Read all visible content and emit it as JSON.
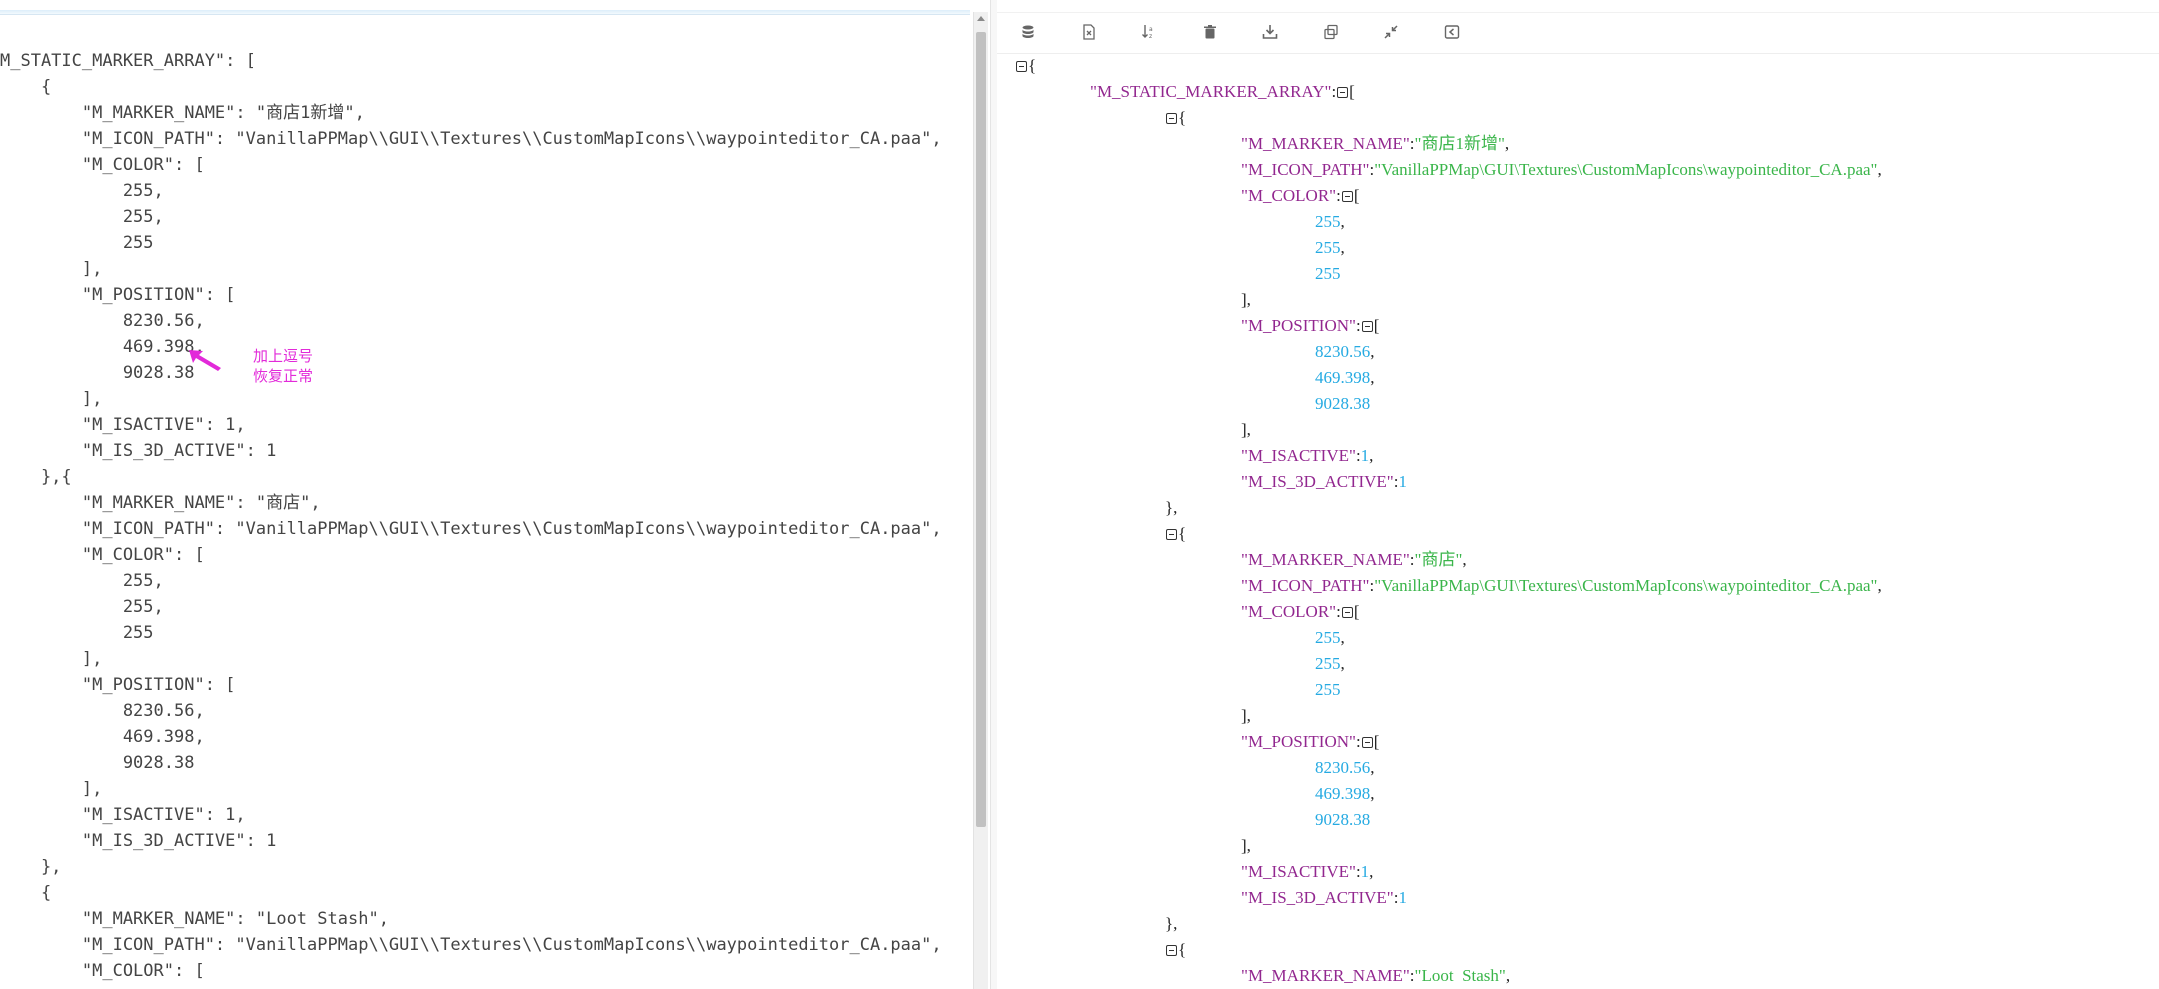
{
  "raw_editor": {
    "lines": [
      "M_STATIC_MARKER_ARRAY\": [",
      "    {",
      "        \"M_MARKER_NAME\": \"商店1新增\",",
      "        \"M_ICON_PATH\": \"VanillaPPMap\\\\GUI\\\\Textures\\\\CustomMapIcons\\\\waypointeditor_CA.paa\",",
      "        \"M_COLOR\": [",
      "            255,",
      "            255,",
      "            255",
      "        ],",
      "        \"M_POSITION\": [",
      "            8230.56,",
      "            469.398,",
      "            9028.38",
      "        ],",
      "        \"M_ISACTIVE\": 1,",
      "        \"M_IS_3D_ACTIVE\": 1",
      "    },{",
      "        \"M_MARKER_NAME\": \"商店\",",
      "        \"M_ICON_PATH\": \"VanillaPPMap\\\\GUI\\\\Textures\\\\CustomMapIcons\\\\waypointeditor_CA.paa\",",
      "        \"M_COLOR\": [",
      "            255,",
      "            255,",
      "            255",
      "        ],",
      "        \"M_POSITION\": [",
      "            8230.56,",
      "            469.398,",
      "            9028.38",
      "        ],",
      "        \"M_ISACTIVE\": 1,",
      "        \"M_IS_3D_ACTIVE\": 1",
      "    },",
      "    {",
      "        \"M_MARKER_NAME\": \"Loot Stash\",",
      "        \"M_ICON_PATH\": \"VanillaPPMap\\\\GUI\\\\Textures\\\\CustomMapIcons\\\\waypointeditor_CA.paa\",",
      "        \"M_COLOR\": ["
    ],
    "annotation": {
      "line1": "加上逗号",
      "line2": "恢复正常",
      "color": "#e22ad9"
    }
  },
  "toolbar": {
    "buttons": [
      {
        "name": "format-icon"
      },
      {
        "name": "compress-icon"
      },
      {
        "name": "sort-icon"
      },
      {
        "name": "clear-icon"
      },
      {
        "name": "download-icon"
      },
      {
        "name": "copy-icon"
      },
      {
        "name": "collapse-icon"
      },
      {
        "name": "share-icon"
      }
    ]
  },
  "formatted_view": {
    "colors": {
      "key": "#92278f",
      "string": "#3ab54a",
      "number": "#25aae2",
      "punct": "#222222"
    },
    "rows": [
      {
        "i": 0,
        "parts": [
          [
            "t"
          ],
          [
            "p",
            "{"
          ]
        ]
      },
      {
        "i": 1,
        "parts": [
          [
            "k",
            "\"M_STATIC_MARKER_ARRAY\""
          ],
          [
            "p",
            ":"
          ],
          [
            "t"
          ],
          [
            "p",
            "["
          ]
        ]
      },
      {
        "i": 2,
        "parts": [
          [
            "t"
          ],
          [
            "p",
            "{"
          ]
        ]
      },
      {
        "i": 3,
        "parts": [
          [
            "k",
            "\"M_MARKER_NAME\""
          ],
          [
            "p",
            ":"
          ],
          [
            "s",
            "\"商店1新增\""
          ],
          [
            "p",
            ","
          ]
        ]
      },
      {
        "i": 3,
        "parts": [
          [
            "k",
            "\"M_ICON_PATH\""
          ],
          [
            "p",
            ":"
          ],
          [
            "s",
            "\"VanillaPPMap\\GUI\\Textures\\CustomMapIcons\\waypointeditor_CA.paa\""
          ],
          [
            "p",
            ","
          ]
        ]
      },
      {
        "i": 3,
        "parts": [
          [
            "k",
            "\"M_COLOR\""
          ],
          [
            "p",
            ":"
          ],
          [
            "t"
          ],
          [
            "p",
            "["
          ]
        ]
      },
      {
        "i": 4,
        "parts": [
          [
            "n",
            "255"
          ],
          [
            "p",
            ","
          ]
        ]
      },
      {
        "i": 4,
        "parts": [
          [
            "n",
            "255"
          ],
          [
            "p",
            ","
          ]
        ]
      },
      {
        "i": 4,
        "parts": [
          [
            "n",
            "255"
          ]
        ]
      },
      {
        "i": 3,
        "parts": [
          [
            "p",
            "],"
          ]
        ]
      },
      {
        "i": 3,
        "parts": [
          [
            "k",
            "\"M_POSITION\""
          ],
          [
            "p",
            ":"
          ],
          [
            "t"
          ],
          [
            "p",
            "["
          ]
        ]
      },
      {
        "i": 4,
        "parts": [
          [
            "n",
            "8230.56"
          ],
          [
            "p",
            ","
          ]
        ]
      },
      {
        "i": 4,
        "parts": [
          [
            "n",
            "469.398"
          ],
          [
            "p",
            ","
          ]
        ]
      },
      {
        "i": 4,
        "parts": [
          [
            "n",
            "9028.38"
          ]
        ]
      },
      {
        "i": 3,
        "parts": [
          [
            "p",
            "],"
          ]
        ]
      },
      {
        "i": 3,
        "parts": [
          [
            "k",
            "\"M_ISACTIVE\""
          ],
          [
            "p",
            ":"
          ],
          [
            "n",
            "1"
          ],
          [
            "p",
            ","
          ]
        ]
      },
      {
        "i": 3,
        "parts": [
          [
            "k",
            "\"M_IS_3D_ACTIVE\""
          ],
          [
            "p",
            ":"
          ],
          [
            "n",
            "1"
          ]
        ]
      },
      {
        "i": 2,
        "parts": [
          [
            "p",
            "},"
          ]
        ]
      },
      {
        "i": 2,
        "parts": [
          [
            "t"
          ],
          [
            "p",
            "{"
          ]
        ]
      },
      {
        "i": 3,
        "parts": [
          [
            "k",
            "\"M_MARKER_NAME\""
          ],
          [
            "p",
            ":"
          ],
          [
            "s",
            "\"商店\""
          ],
          [
            "p",
            ","
          ]
        ]
      },
      {
        "i": 3,
        "parts": [
          [
            "k",
            "\"M_ICON_PATH\""
          ],
          [
            "p",
            ":"
          ],
          [
            "s",
            "\"VanillaPPMap\\GUI\\Textures\\CustomMapIcons\\waypointeditor_CA.paa\""
          ],
          [
            "p",
            ","
          ]
        ]
      },
      {
        "i": 3,
        "parts": [
          [
            "k",
            "\"M_COLOR\""
          ],
          [
            "p",
            ":"
          ],
          [
            "t"
          ],
          [
            "p",
            "["
          ]
        ]
      },
      {
        "i": 4,
        "parts": [
          [
            "n",
            "255"
          ],
          [
            "p",
            ","
          ]
        ]
      },
      {
        "i": 4,
        "parts": [
          [
            "n",
            "255"
          ],
          [
            "p",
            ","
          ]
        ]
      },
      {
        "i": 4,
        "parts": [
          [
            "n",
            "255"
          ]
        ]
      },
      {
        "i": 3,
        "parts": [
          [
            "p",
            "],"
          ]
        ]
      },
      {
        "i": 3,
        "parts": [
          [
            "k",
            "\"M_POSITION\""
          ],
          [
            "p",
            ":"
          ],
          [
            "t"
          ],
          [
            "p",
            "["
          ]
        ]
      },
      {
        "i": 4,
        "parts": [
          [
            "n",
            "8230.56"
          ],
          [
            "p",
            ","
          ]
        ]
      },
      {
        "i": 4,
        "parts": [
          [
            "n",
            "469.398"
          ],
          [
            "p",
            ","
          ]
        ]
      },
      {
        "i": 4,
        "parts": [
          [
            "n",
            "9028.38"
          ]
        ]
      },
      {
        "i": 3,
        "parts": [
          [
            "p",
            "],"
          ]
        ]
      },
      {
        "i": 3,
        "parts": [
          [
            "k",
            "\"M_ISACTIVE\""
          ],
          [
            "p",
            ":"
          ],
          [
            "n",
            "1"
          ],
          [
            "p",
            ","
          ]
        ]
      },
      {
        "i": 3,
        "parts": [
          [
            "k",
            "\"M_IS_3D_ACTIVE\""
          ],
          [
            "p",
            ":"
          ],
          [
            "n",
            "1"
          ]
        ]
      },
      {
        "i": 2,
        "parts": [
          [
            "p",
            "},"
          ]
        ]
      },
      {
        "i": 2,
        "parts": [
          [
            "t"
          ],
          [
            "p",
            "{"
          ]
        ]
      },
      {
        "i": 3,
        "parts": [
          [
            "k",
            "\"M_MARKER_NAME\""
          ],
          [
            "p",
            ":"
          ],
          [
            "s",
            "\"Loot  Stash\""
          ],
          [
            "p",
            ","
          ]
        ]
      }
    ]
  }
}
